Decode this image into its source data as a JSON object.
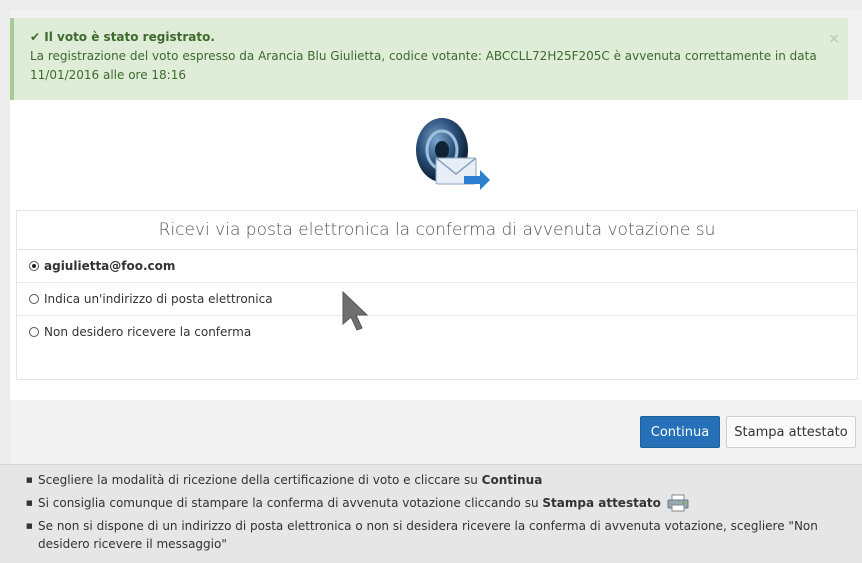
{
  "alert": {
    "check_icon": "check-icon",
    "title": "Il voto è stato registrato.",
    "message": "La registrazione del voto espresso da Arancia Blu Giulietta, codice votante: ABCCLL72H25F205C è avvenuta correttamente in data 11/01/2016 alle ore 18:16",
    "close": "×"
  },
  "confirm": {
    "title": "Ricevi via posta elettronica la conferma di avvenuta votazione su",
    "options": [
      {
        "label": "agiulietta@foo.com",
        "selected": true
      },
      {
        "label": "Indica un'indirizzo di posta elettronica",
        "selected": false
      },
      {
        "label": "Non desidero ricevere la conferma",
        "selected": false
      }
    ]
  },
  "buttons": {
    "continue": "Continua",
    "print": "Stampa attestato"
  },
  "notes": {
    "n1_text": "Scegliere la modalità di ricezione della certificazione di voto e cliccare su ",
    "n1_bold": "Continua",
    "n2_text": "Si consiglia comunque di stampare la conferma di avvenuta votazione cliccando su ",
    "n2_bold": "Stampa attestato",
    "n3_text": "Se non si dispone di un indirizzo di posta elettronica o non si desidera ricevere la conferma di avvenuta votazione, scegliere \"Non desidero ricevere il messaggio\""
  },
  "colors": {
    "alert_bg": "#dfecd8",
    "alert_text": "#3c6b2d",
    "primary": "#2670b8"
  }
}
